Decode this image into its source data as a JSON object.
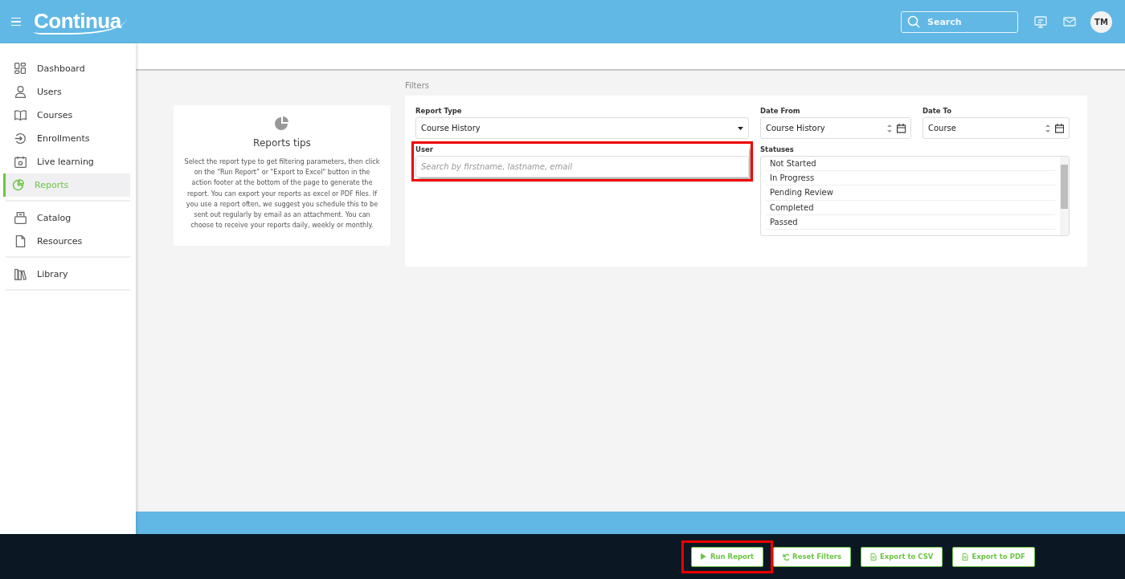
{
  "header": {
    "logo": "Continua",
    "search": {
      "placeholder": "Search"
    },
    "avatar": "TM"
  },
  "sidebar": {
    "sections": [
      [
        {
          "label": "Dashboard",
          "kind": "dashboard",
          "selected": false
        },
        {
          "label": "Users",
          "kind": "user",
          "selected": false
        },
        {
          "label": "Courses",
          "kind": "book",
          "selected": false
        },
        {
          "label": "Enrollments",
          "kind": "enroll",
          "selected": false
        },
        {
          "label": "Live learning",
          "kind": "live",
          "selected": false
        },
        {
          "label": "Reports",
          "kind": "chart",
          "selected": true
        }
      ],
      [
        {
          "label": "Catalog",
          "kind": "catalog",
          "selected": false
        },
        {
          "label": "Resources",
          "kind": "file",
          "selected": false
        }
      ],
      [
        {
          "label": "Library",
          "kind": "library",
          "selected": false
        }
      ]
    ]
  },
  "tips": {
    "title": "Reports tips",
    "text": "Select the report type to get filtering parameters, then click on the “Run Report” or \"Export to Excel\" button in the action footer at the bottom of the page to generate the report. You can export your reports as excel or PDF files. If you use a report often, we suggest you schedule this to be sent out regularly by email as an attachment. You can choose to receive your reports daily, weekly or monthly."
  },
  "filters": {
    "title": "Filters",
    "report_type": {
      "label": "Report Type",
      "value": "Course History"
    },
    "user": {
      "label": "User",
      "placeholder": "Search by firstname, lastname, email",
      "highlighted": true
    },
    "date_from": {
      "label": "Date From",
      "value": "Course History"
    },
    "date_to": {
      "label": "Date To",
      "value": "Course"
    },
    "statuses": {
      "label": "Statuses",
      "items": [
        "Not Started",
        "In Progress",
        "Pending Review",
        "Completed",
        "Passed"
      ]
    }
  },
  "footer": {
    "buttons": [
      {
        "label": "Run Report",
        "kind": "play",
        "highlighted": true
      },
      {
        "label": "Reset Filters",
        "kind": "reset",
        "highlighted": false
      },
      {
        "label": "Export to CSV",
        "kind": "doc",
        "highlighted": false
      },
      {
        "label": "Export to PDF",
        "kind": "doc",
        "highlighted": false
      }
    ]
  }
}
